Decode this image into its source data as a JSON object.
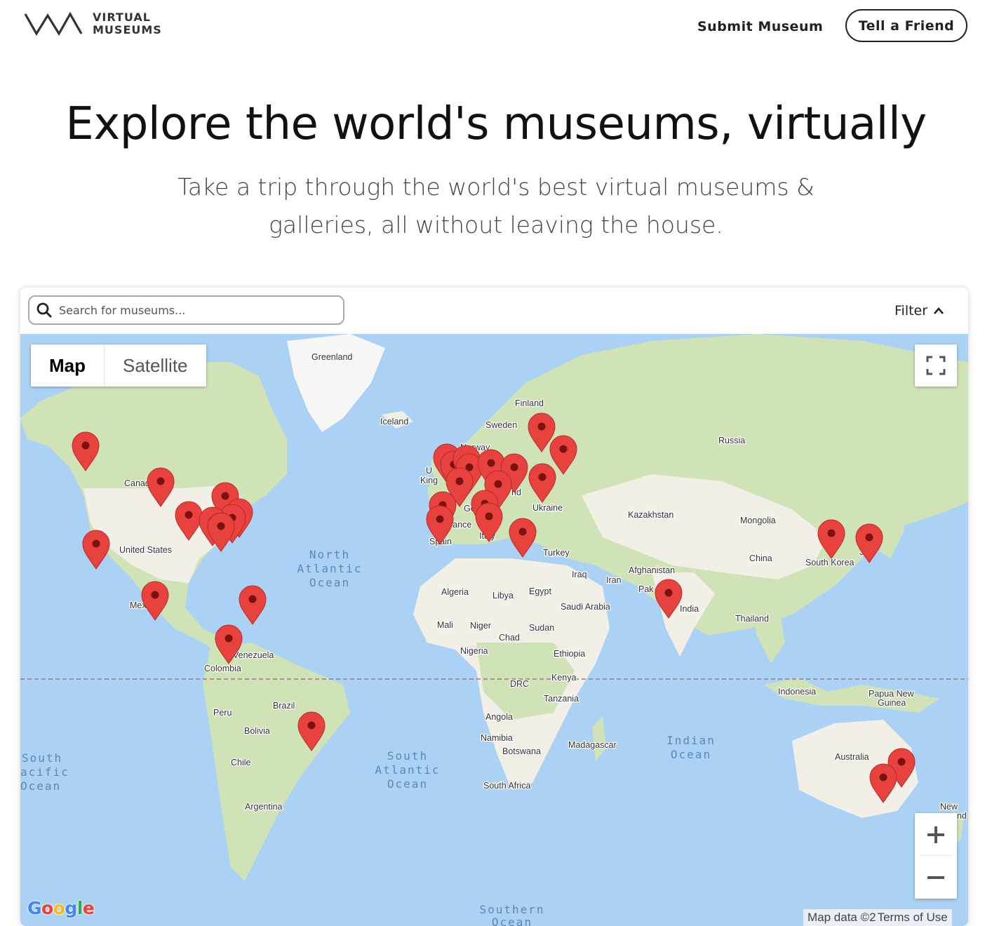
{
  "brand": {
    "line1": "VIRTUAL",
    "line2": "MUSEUMS"
  },
  "nav": {
    "submit": "Submit Museum",
    "tell": "Tell a Friend"
  },
  "hero": {
    "title": "Explore the world's museums, virtually",
    "subtitle": "Take a trip through the world's best virtual museums & galleries, all without leaving the house."
  },
  "search": {
    "placeholder": "Search for museums..."
  },
  "filter": {
    "label": "Filter"
  },
  "map": {
    "types": {
      "map": "Map",
      "satellite": "Satellite"
    },
    "attribution": {
      "data": "Map data ©2",
      "terms": "Terms of Use"
    },
    "countries": {
      "greenland": "Greenland",
      "iceland": "Iceland",
      "finland": "Finland",
      "sweden": "Sweden",
      "norway": "Norway",
      "russia": "Russia",
      "canada": "Canad",
      "united_states": "United States",
      "mexico": "Mex",
      "venezuela": "Venezuela",
      "colombia": "Colombia",
      "brazil": "Brazil",
      "peru": "Peru",
      "bolivia": "Bolivia",
      "chile": "Chile",
      "argentina": "Argentina",
      "uk_1": "U",
      "uk_2": "King",
      "ukraine": "Ukraine",
      "france": "rance",
      "spain": "Spain",
      "italy": "Italy",
      "germany": "Ge",
      "poland": "nd",
      "turkey": "Turkey",
      "kazakhstan": "Kazakhstan",
      "mongolia": "Mongolia",
      "china": "China",
      "south_korea": "South Korea",
      "japan": "Jan",
      "iraq": "Iraq",
      "iran": "Iran",
      "afghanistan": "Afghanistan",
      "pakistan": "Pak",
      "india": "India",
      "thailand": "Thailand",
      "algeria": "Algeria",
      "libya": "Libya",
      "egypt": "Egypt",
      "saudi_arabia": "Saudi Arabia",
      "mali": "Mali",
      "niger": "Niger",
      "chad": "Chad",
      "sudan": "Sudan",
      "nigeria": "Nigeria",
      "ethiopia": "Ethiopia",
      "drc": "DRC",
      "kenya": "Kenya",
      "tanzania": "Tanzania",
      "angola": "Angola",
      "namibia": "Namibia",
      "botswana": "Botswana",
      "south_africa": "South Africa",
      "madagascar": "Madagascar",
      "indonesia": "Indonesia",
      "png_1": "Papua New",
      "png_2": "Guinea",
      "australia": "Australia",
      "nz_1": "New",
      "nz_2": "nd"
    },
    "oceans": {
      "north_atlantic": [
        "North",
        "Atlantic",
        "Ocean"
      ],
      "south_atlantic": [
        "South",
        "Atlantic",
        "Ocean"
      ],
      "south_pacific": [
        "South",
        "acific",
        "Ocean"
      ],
      "indian": [
        "Indian",
        "Ocean"
      ],
      "southern": [
        "Southern",
        "Ocean"
      ]
    },
    "colors": {
      "water": "#abd2f5",
      "land": "#f1efe6",
      "forest": "#cfe3b6",
      "pin": "#e8423f",
      "pin_dot": "#7a1210"
    }
  }
}
